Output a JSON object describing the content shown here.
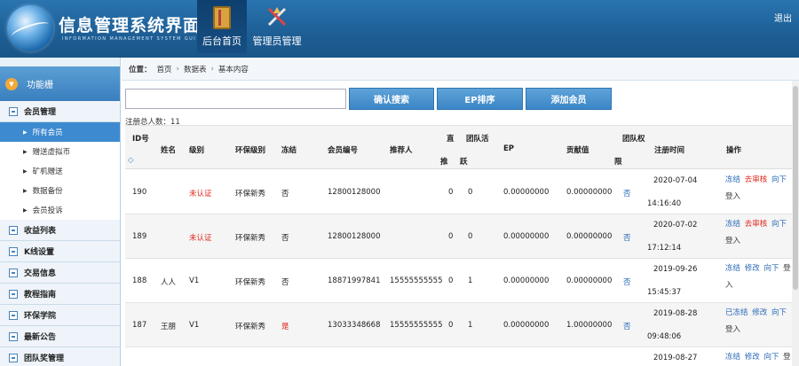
{
  "header": {
    "title": "信息管理系统界面",
    "subtitle": "INFORMATION MANAGEMENT SYSTEM GUI",
    "nav": [
      {
        "label": "后台首页",
        "active": true
      },
      {
        "label": "管理员管理",
        "active": false
      }
    ],
    "logout": "退出"
  },
  "sidebar": {
    "header": "功能栅",
    "sections": [
      {
        "label": "会员管理",
        "items": [
          {
            "label": "所有会员",
            "active": true
          },
          {
            "label": "赠送虚拟币",
            "active": false
          },
          {
            "label": "矿机赠送",
            "active": false
          },
          {
            "label": "数据备份",
            "active": false
          },
          {
            "label": "会员投诉",
            "active": false
          }
        ]
      },
      {
        "label": "收益列表"
      },
      {
        "label": "K线设置"
      },
      {
        "label": "交易信息"
      },
      {
        "label": "教程指南"
      },
      {
        "label": "环保学院"
      },
      {
        "label": "最新公告"
      },
      {
        "label": "团队奖管理"
      }
    ]
  },
  "breadcrumb": {
    "label": "位置：",
    "items": [
      "首页",
      "数据表",
      "基本内容"
    ]
  },
  "search": {
    "value": "",
    "placeholder": ""
  },
  "buttons": {
    "confirm": "确认搜索",
    "ep_sort": "EP排序",
    "add_member": "添加会员"
  },
  "count_text": "注册总人数：11",
  "table": {
    "headers": {
      "id": "ID号",
      "sort": "◇",
      "name": "姓名",
      "level": "级别",
      "eco_level": "环保级别",
      "frozen": "冻结",
      "member_no": "会员编号",
      "referrer": "推荐人",
      "direct_1": "直",
      "direct_2": "推",
      "team_active_1": "团队活",
      "team_active_2": "跃",
      "ep": "EP",
      "contribution": "贡献值",
      "team_right_1": "团队权",
      "team_right_2": "限",
      "reg_time": "注册时间",
      "ops": "操作"
    },
    "rows": [
      {
        "id": "190",
        "name": "",
        "level": "未认证",
        "level_red": true,
        "eco": "环保新秀",
        "frozen": "否",
        "frozen_red": false,
        "member_no": "12800128000",
        "referrer": "",
        "direct": "0",
        "team_active": "0",
        "ep": "0.00000000",
        "contribution": "0.00000000",
        "team_right": "否",
        "date": "2020-07-04",
        "time": "14:16:40",
        "ops": [
          {
            "text": "冻结",
            "color": "blue"
          },
          {
            "text": "去审核",
            "color": "red"
          },
          {
            "text": "向下",
            "color": "blue"
          },
          {
            "text": "登入",
            "color": "dark"
          }
        ]
      },
      {
        "id": "189",
        "name": "",
        "level": "未认证",
        "level_red": true,
        "eco": "环保新秀",
        "frozen": "否",
        "frozen_red": false,
        "member_no": "12800128000",
        "referrer": "",
        "direct": "0",
        "team_active": "0",
        "ep": "0.00000000",
        "contribution": "0.00000000",
        "team_right": "否",
        "date": "2020-07-02",
        "time": "17:12:14",
        "ops": [
          {
            "text": "冻结",
            "color": "blue"
          },
          {
            "text": "去审核",
            "color": "red"
          },
          {
            "text": "向下",
            "color": "blue"
          },
          {
            "text": "登入",
            "color": "dark"
          }
        ]
      },
      {
        "id": "188",
        "name": "人人",
        "level": "V1",
        "level_red": false,
        "eco": "环保新秀",
        "frozen": "否",
        "frozen_red": false,
        "member_no": "18871997841",
        "referrer": "15555555555",
        "direct": "0",
        "team_active": "1",
        "ep": "0.00000000",
        "contribution": "0.00000000",
        "team_right": "否",
        "date": "2019-09-26",
        "time": "15:45:37",
        "ops": [
          {
            "text": "冻结",
            "color": "blue"
          },
          {
            "text": "修改",
            "color": "blue"
          },
          {
            "text": "向下",
            "color": "blue"
          },
          {
            "text": "登入",
            "color": "dark"
          }
        ]
      },
      {
        "id": "187",
        "name": "王朋",
        "level": "V1",
        "level_red": false,
        "eco": "环保新秀",
        "frozen": "是",
        "frozen_red": true,
        "member_no": "13033348668",
        "referrer": "15555555555",
        "direct": "0",
        "team_active": "1",
        "ep": "0.00000000",
        "contribution": "1.00000000",
        "team_right": "否",
        "date": "2019-08-28",
        "time": "09:48:06",
        "ops": [
          {
            "text": "已冻结",
            "color": "blue"
          },
          {
            "text": "修改",
            "color": "blue"
          },
          {
            "text": "向下",
            "color": "blue"
          },
          {
            "text": "登入",
            "color": "dark"
          }
        ]
      },
      {
        "id": "",
        "name": "",
        "level": "",
        "level_red": false,
        "eco": "",
        "frozen": "",
        "frozen_red": false,
        "member_no": "",
        "referrer": "",
        "direct": "",
        "team_active": "",
        "ep": "",
        "contribution": "",
        "team_right": "",
        "date": "2019-08-27",
        "time": "",
        "ops": [
          {
            "text": "冻结",
            "color": "blue"
          },
          {
            "text": "修改",
            "color": "blue"
          },
          {
            "text": "向下",
            "color": "blue"
          },
          {
            "text": "登",
            "color": "dark"
          }
        ]
      }
    ]
  },
  "colors": {
    "header_blue": "#1d5e95",
    "accent_blue": "#3d8ad0",
    "red": "#e0251b",
    "link_blue": "#2a6ab8"
  }
}
